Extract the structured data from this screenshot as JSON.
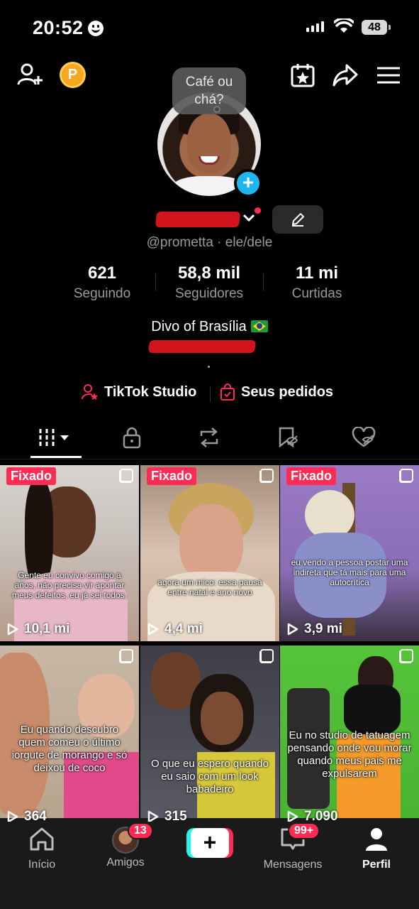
{
  "status_bar": {
    "time": "20:52",
    "battery": "48"
  },
  "profile": {
    "bubble_text": "Café ou chá?",
    "handle": "@prometta · ele/dele",
    "coin_letter": "P",
    "bio": "Divo of Brasília",
    "stats": [
      {
        "value": "621",
        "label": "Seguindo"
      },
      {
        "value": "58,8 mil",
        "label": "Seguidores"
      },
      {
        "value": "11 mi",
        "label": "Curtidas"
      }
    ],
    "links": {
      "studio": "TikTok Studio",
      "orders": "Seus pedidos"
    }
  },
  "pinned_label": "Fixado",
  "videos": [
    {
      "pinned": true,
      "caption": "Gente eu convivo comigo a anos, não precisa vir apontar meus defeitos, eu já sei todos.",
      "views": "10,1 mi"
    },
    {
      "pinned": true,
      "caption": "agora um mico: essa pausa entre natal e ano novo",
      "views": "4,4 mi"
    },
    {
      "pinned": true,
      "caption": "eu vendo a pessoa postar uma indireta que tá mais para uma autocrítica",
      "views": "3,9 mi"
    },
    {
      "pinned": false,
      "caption": "Eu quando descubro quem comeu o último iorgute de morango e só deixou de coco",
      "views": "364"
    },
    {
      "pinned": false,
      "caption": "O que eu espero quando eu saio com um look babadeiro",
      "views": "315"
    },
    {
      "pinned": false,
      "caption": "Eu no studio de tatuagem pensando onde vou morar quando meus pais me expulsarem",
      "views": "7.090"
    }
  ],
  "bottom_nav": {
    "home": "Início",
    "friends": "Amigos",
    "friends_badge": "13",
    "messages": "Mensagens",
    "messages_badge": "99+",
    "profile": "Perfil"
  },
  "colors": {
    "accent": "#fe2c55",
    "cyan": "#25f4ee",
    "muted": "#9a9a9a"
  }
}
